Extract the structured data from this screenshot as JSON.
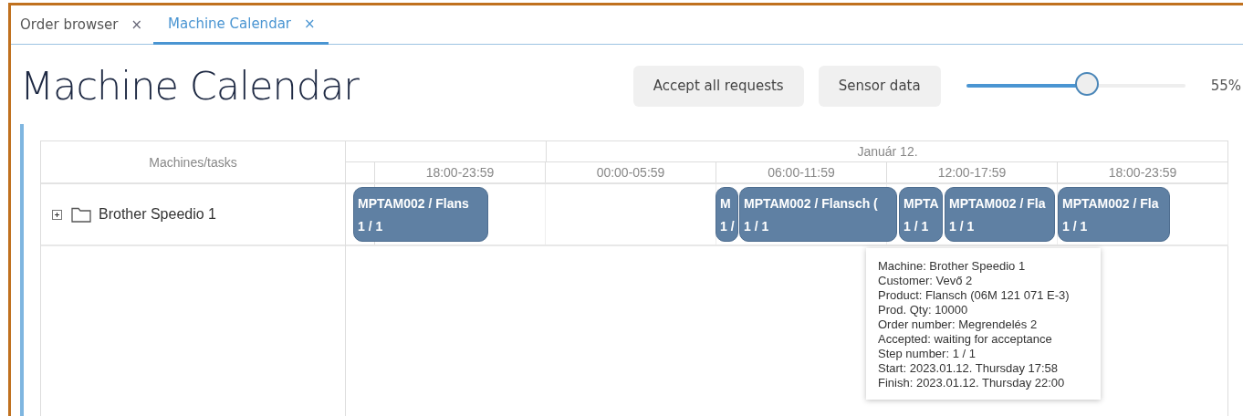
{
  "tabs": [
    {
      "label": "Order browser",
      "close": "×",
      "selected": false
    },
    {
      "label": "Machine Calendar",
      "close": "×",
      "selected": true
    }
  ],
  "title": "Machine Calendar",
  "buttons": [
    "Accept all requests",
    "Sensor data"
  ],
  "zoom": {
    "level": 0.55,
    "reading": "55%"
  },
  "calendar": {
    "machines_header": "Machines/tasks",
    "date": "Január 12.",
    "slots": [
      "18:00-23:59",
      "00:00-05:59",
      "06:00-11:59",
      "12:00-17:59",
      "18:00-23:59"
    ],
    "machines": [
      {
        "name": "Brother Speedio 1",
        "expanded": false,
        "tasks": [
          {
            "title": "MPTAM002 / Flans",
            "step": "1 / 1"
          },
          {
            "title": "M",
            "step": "1 /"
          },
          {
            "title": "MPTAM002 / Flansch (",
            "step": "1 / 1"
          },
          {
            "title": "MPTA",
            "step": "1 / 1"
          },
          {
            "title": "MPTAM002 / Fla",
            "step": "1 / 1"
          },
          {
            "title": "MPTAM002 / Fla",
            "step": "1 / 1"
          }
        ]
      }
    ]
  },
  "tooltip": [
    "Machine: Brother Speedio 1",
    "Customer: Vevő 2",
    "Product: Flansch (06M 121 071 E-3)",
    "Prod. Qty: 10000",
    "Order number: Megrendelés 2",
    "Accepted: waiting for acceptance",
    "Step number: 1 / 1",
    "Start: 2023.01.12. Thursday 17:58",
    "Finish: 2023.01.12. Thursday 22:00"
  ]
}
